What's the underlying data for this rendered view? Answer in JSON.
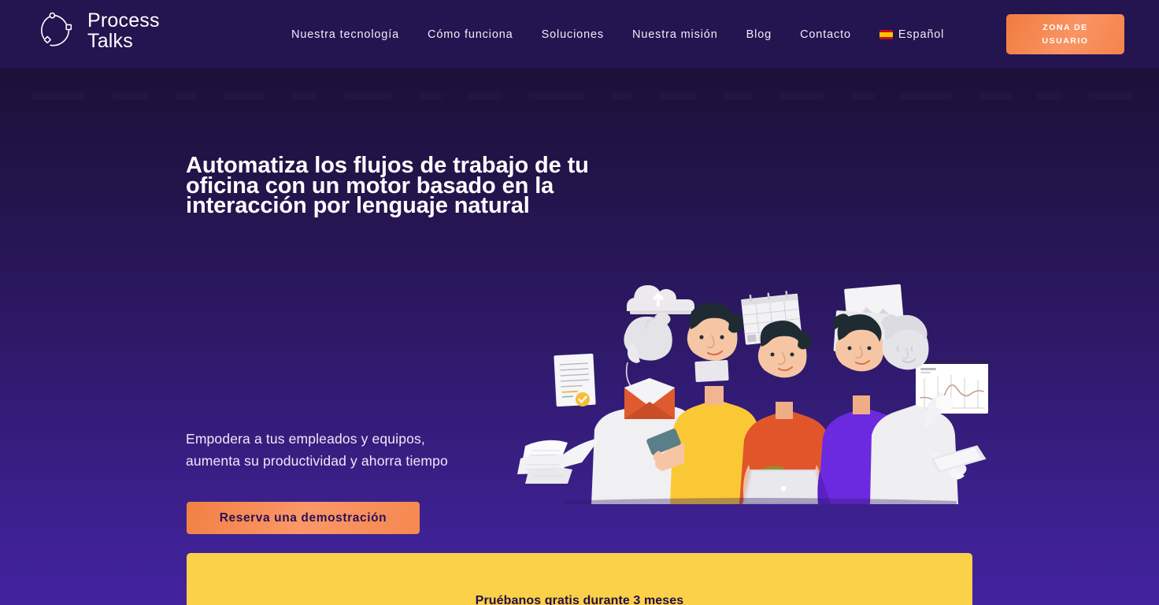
{
  "brand": {
    "name": "Process\nTalks",
    "logo_icon": "process-talks-circle-nodes-logo"
  },
  "nav": {
    "items": [
      {
        "label": "Nuestra tecnología",
        "icon": null
      },
      {
        "label": "Cómo funciona",
        "icon": null
      },
      {
        "label": "Soluciones",
        "icon": null
      },
      {
        "label": "Nuestra misión",
        "icon": null
      },
      {
        "label": "Blog",
        "icon": null
      },
      {
        "label": "Contacto",
        "icon": null
      },
      {
        "label": "Español",
        "icon": "spain-flag-icon"
      }
    ],
    "cta_label": "ZONA DE\nUSUARIO"
  },
  "hero": {
    "title_line1": "Automatiza los flujos de trabajo de tu",
    "title_line2": "oficina con un motor basado en la",
    "title_line3": "interacción por lenguaje natural",
    "subtitle_line1": "Empodera a tus empleados y equipos,",
    "subtitle_line2": "aumenta su productividad y ahorra tiempo",
    "cta_label": "Reserva una demostración"
  },
  "promo": {
    "text": "Pruébanos gratis durante 3 meses"
  },
  "illustration": {
    "name": "team-collaboration-illustration",
    "elements": [
      "cloud-upload-icon",
      "document-page-with-check-badge",
      "calendar-card",
      "photo-card",
      "envelope-mail-icon",
      "analytics-chart-panel",
      "laptop",
      "smartphone",
      "tablet",
      "people-group"
    ]
  },
  "colors": {
    "header_bg": "#241450",
    "bg_top": "#1a0e33",
    "bg_bottom": "#43239e",
    "accent_orange": "#f5884f",
    "promo_yellow": "#fcd14a",
    "text_light": "#ffffff",
    "shirt_yellow": "#fbc835",
    "shirt_orange": "#e0562a",
    "shirt_purple": "#6b2ae0",
    "skin": "#f5c1a0",
    "hair_dark": "#1e2b33",
    "grey_figure": "#e9e9ec"
  }
}
